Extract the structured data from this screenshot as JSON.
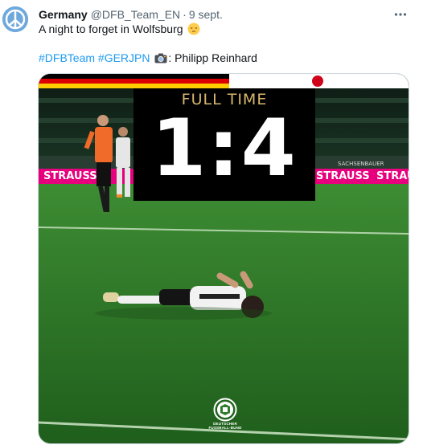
{
  "tweet": {
    "display_name": "Germany",
    "handle": "@DFB_Team_EN",
    "separator": "·",
    "date": "9 sept.",
    "more_icon": "more-dots-icon",
    "text_line1": "A night to forget in Wolfsburg",
    "text_emoji": "pensive-face-icon",
    "hashtags": [
      "#DFBTeam",
      "#GERJPN"
    ],
    "camera_icon": "camera-icon",
    "credit": ": Philipp Reinhard"
  },
  "media": {
    "score_label": "FULL TIME",
    "score": "1:4",
    "board_text_left": "STRAUSS",
    "board_text_right": "STRAUSS",
    "board_text_right2": "STRAU",
    "board_text_mid": "SACHSENBAUER",
    "logo_line1": "DEUTSCHER",
    "logo_line2": "FUSSBALL-BUND",
    "colors": {
      "gold": "#d8b76c",
      "german_black": "#000000",
      "german_red": "#dd0000",
      "german_gold": "#ffce00",
      "japan_red": "#d0021b",
      "pitch": "#2f7d2a",
      "board_magenta": "#e6007e"
    }
  }
}
